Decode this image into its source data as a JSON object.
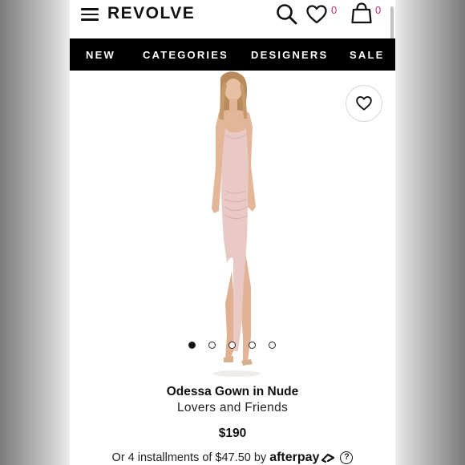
{
  "header": {
    "logo": "REVOLVE",
    "wishlist_count": "0",
    "cart_count": "0"
  },
  "nav": {
    "items": [
      "NEW",
      "CATEGORIES",
      "DESIGNERS",
      "SALE"
    ]
  },
  "gallery": {
    "image_count": 5,
    "active_index": 0
  },
  "product": {
    "name": "Odessa Gown in Nude",
    "brand": "Lovers and Friends",
    "price": "$190",
    "installment_text": "Or 4 installments of $47.50 by",
    "afterpay_label": "afterpay",
    "help_symbol": "?"
  },
  "colors": {
    "nav_bg": "#000000",
    "badge": "#c0267a",
    "dress": "#e8c9c3"
  }
}
